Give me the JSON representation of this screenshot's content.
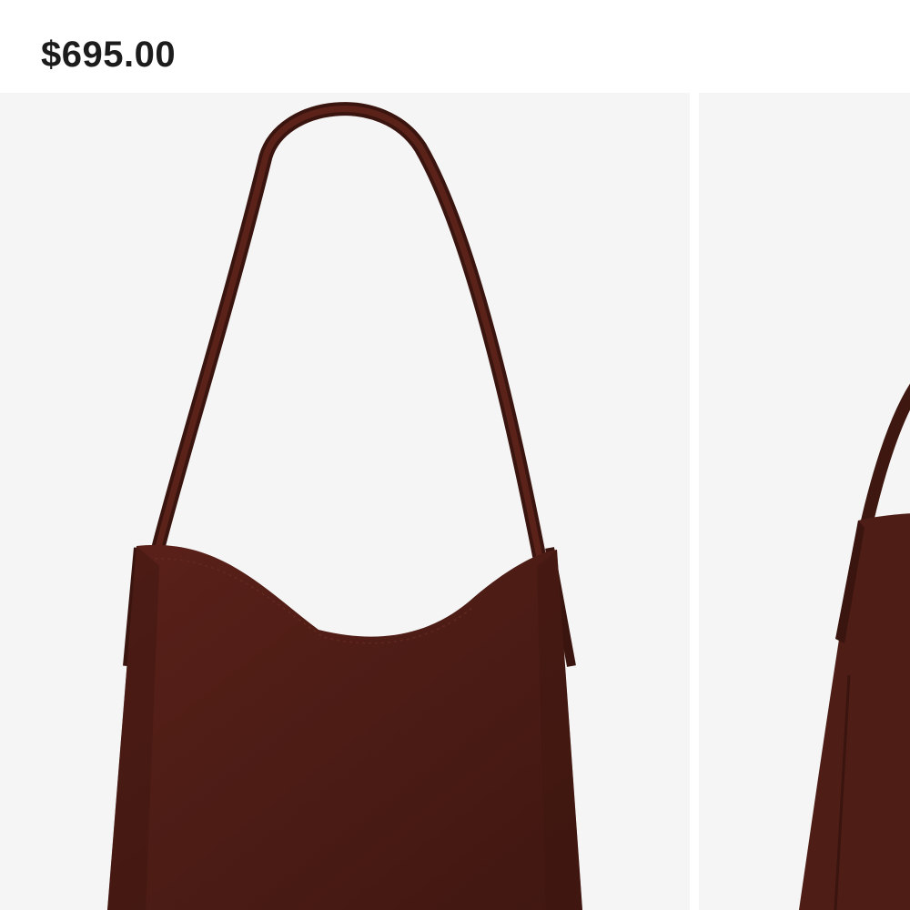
{
  "product": {
    "price": "$695.00"
  },
  "gallery": {
    "images": [
      {
        "name": "product-image-front",
        "color": "#4e1d16"
      },
      {
        "name": "product-image-side",
        "color": "#4e1d16"
      }
    ]
  },
  "colors": {
    "background": "#ffffff",
    "image_background": "#f5f5f5",
    "price_text": "#1c1c1c",
    "suede": "#4e1d16",
    "strap": "#3e1710"
  }
}
